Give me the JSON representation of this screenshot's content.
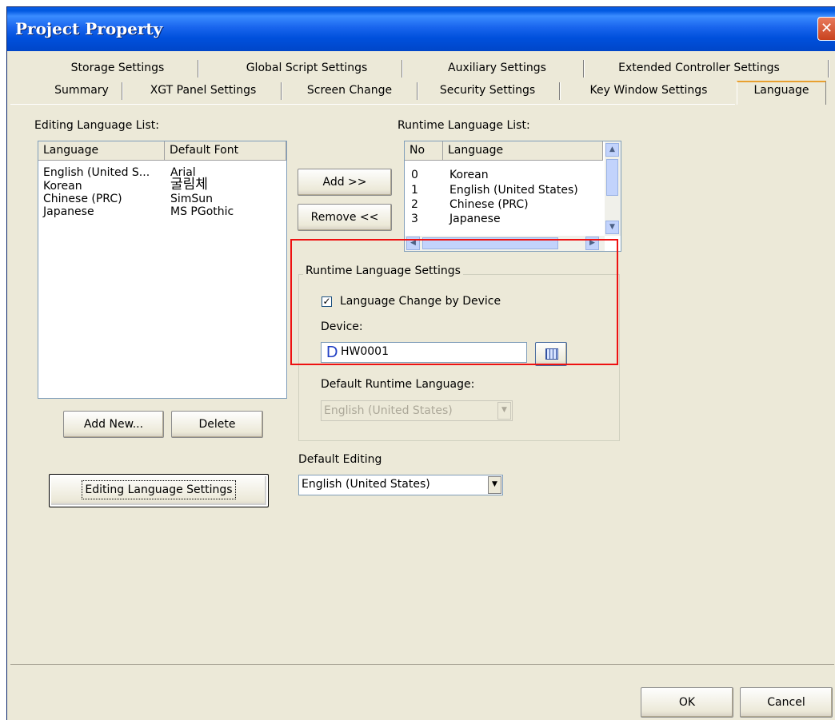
{
  "window": {
    "title": "Project Property",
    "close_glyph": "✕"
  },
  "tabs_row1": [
    "Storage Settings",
    "Global Script Settings",
    "Auxiliary Settings",
    "Extended Controller Settings"
  ],
  "tabs_row2": [
    "Summary",
    "XGT Panel Settings",
    "Screen Change",
    "Security Settings",
    "Key Window Settings",
    "Language"
  ],
  "active_tab": "Language",
  "editing_list": {
    "label": "Editing Language List:",
    "columns": [
      "Language",
      "Default Font"
    ],
    "rows": [
      [
        "English (United S...",
        "Arial"
      ],
      [
        "Korean",
        "굴림체"
      ],
      [
        "Chinese (PRC)",
        "SimSun"
      ],
      [
        "Japanese",
        "MS PGothic"
      ]
    ]
  },
  "runtime_list": {
    "label": "Runtime Language List:",
    "columns": [
      "No",
      "Language"
    ],
    "rows": [
      [
        "0",
        "Korean"
      ],
      [
        "1",
        "English (United States)"
      ],
      [
        "2",
        "Chinese (PRC)"
      ],
      [
        "3",
        "Japanese"
      ]
    ]
  },
  "buttons": {
    "add": "Add >>",
    "remove": "Remove <<",
    "add_new": "Add New...",
    "delete": "Delete",
    "editing_language_settings": "Editing Language Settings",
    "ok": "OK",
    "cancel": "Cancel"
  },
  "runtime_settings": {
    "group_title": "Runtime Language Settings",
    "checkbox_label": "Language Change by Device",
    "checkbox_checked": true,
    "device_label": "Device:",
    "device_prefix": "D",
    "device_value": "HW0001",
    "default_runtime_label": "Default Runtime Language:",
    "default_runtime_value": "English (United States)"
  },
  "default_editing": {
    "label": "Default Editing",
    "value": "English (United States)"
  },
  "colors": {
    "highlight_box": "#ee1111",
    "titlebar": "#0058e0",
    "dialog_bg": "#ece9d8"
  }
}
